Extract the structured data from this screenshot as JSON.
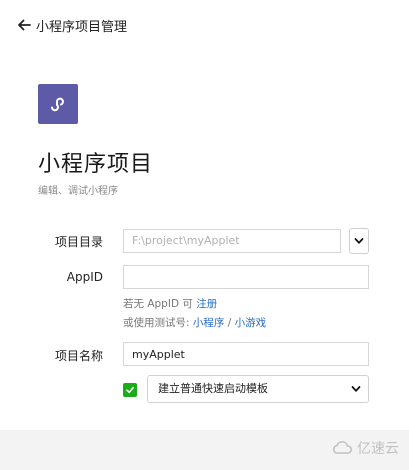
{
  "header": {
    "title": "小程序项目管理",
    "back_icon": "arrow-left-icon"
  },
  "logo": {
    "icon": "mini-program-logo-icon",
    "color": "#5d5aa8"
  },
  "page": {
    "title": "小程序项目",
    "subtitle": "编辑、调试小程序"
  },
  "form": {
    "directory": {
      "label": "项目目录",
      "value": "F:\\project\\myApplet"
    },
    "appid": {
      "label": "AppID",
      "value": "",
      "hint_prefix": "若无 AppID 可",
      "register_link": "注册",
      "test_prefix": "或使用测试号:",
      "mini_program_link": "小程序",
      "separator": "/",
      "mini_game_link": "小游戏"
    },
    "name": {
      "label": "项目名称",
      "value": "myApplet"
    },
    "template": {
      "checked": true,
      "selected": "建立普通快速启动模板"
    }
  },
  "footer": {
    "watermark": "亿速云"
  },
  "colors": {
    "accent": "#1aad19",
    "link": "#2a6cc8",
    "logo": "#5d5aa8"
  }
}
